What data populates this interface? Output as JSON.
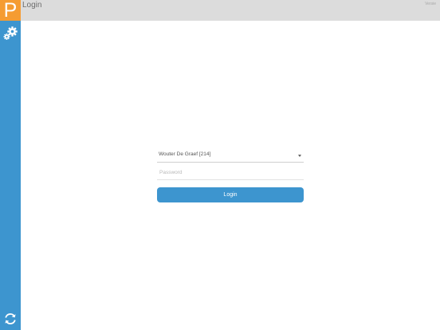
{
  "app": {
    "logo_letter": "P",
    "brand_color": "#f59c32",
    "accent_color": "#3d95cf"
  },
  "header": {
    "title": "Login",
    "version_label": "Versie"
  },
  "sidebar": {
    "top_icon": "settings-gears-icon",
    "bottom_icon": "sync-icon"
  },
  "login": {
    "user_selected": "Wouter De Graef [214]",
    "password_value": "",
    "password_placeholder": "Password",
    "button_label": "Login"
  }
}
